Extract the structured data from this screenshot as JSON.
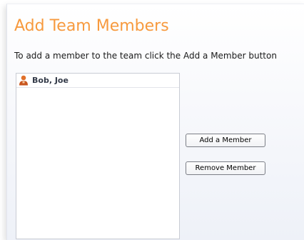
{
  "page": {
    "title": "Add Team Members",
    "instructions": "To add a member to the team click the Add a Member button"
  },
  "members": [
    {
      "name": "Bob, Joe",
      "icon": "user-icon"
    }
  ],
  "buttons": {
    "add_label": "Add a Member",
    "remove_label": "Remove Member"
  },
  "colors": {
    "title": "#f79a3e",
    "user_icon": "#e0702a"
  }
}
